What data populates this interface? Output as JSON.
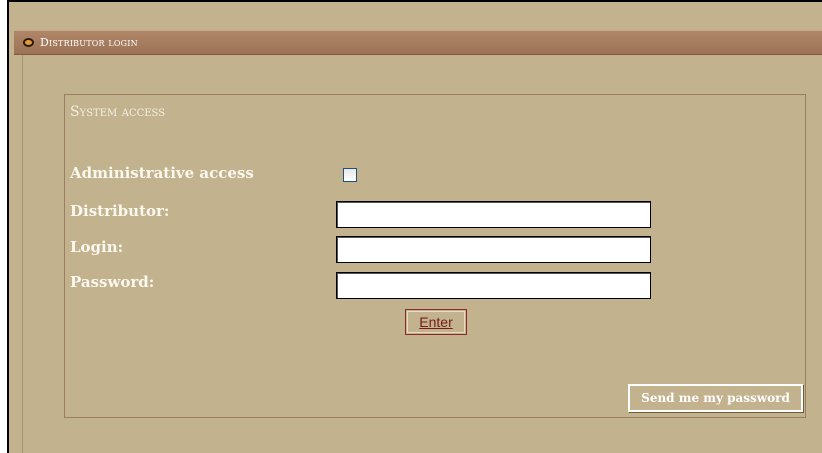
{
  "header": {
    "title": "Distributor login",
    "bullet_icon": "circle-bullet-icon"
  },
  "fieldset": {
    "title": "System access"
  },
  "form": {
    "admin_label": "Administrative access",
    "admin_checked": false,
    "distributor_label": "Distributor:",
    "distributor_value": "",
    "login_label": "Login:",
    "login_value": "",
    "password_label": "Password:",
    "password_value": "",
    "enter_label": "Enter",
    "send_password_label": "Send me my password"
  },
  "colors": {
    "background": "#c2b28d",
    "header_bar": "#9c7356",
    "label_text": "#fbf8ef",
    "enter_text": "#7a1c1c"
  }
}
